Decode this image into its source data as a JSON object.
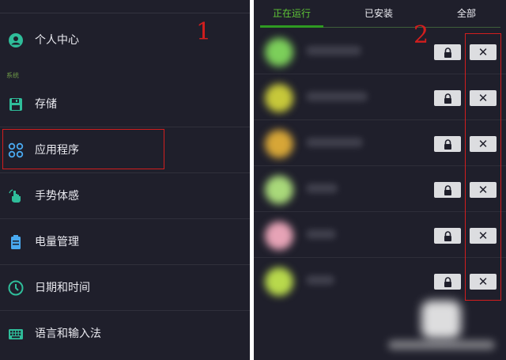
{
  "settings": {
    "section_label": "系统",
    "items": [
      {
        "label": "个人中心",
        "icon": "person-circle-icon"
      },
      {
        "label": "存储",
        "icon": "floppy-disk-icon"
      },
      {
        "label": "应用程序",
        "icon": "apps-grid-icon"
      },
      {
        "label": "手势体感",
        "icon": "gesture-hand-icon"
      },
      {
        "label": "电量管理",
        "icon": "battery-icon"
      },
      {
        "label": "日期和时间",
        "icon": "clock-icon"
      },
      {
        "label": "语言和输入法",
        "icon": "keyboard-icon"
      }
    ],
    "annotation_number": "1"
  },
  "apps": {
    "tabs": [
      {
        "label": "正在运行",
        "active": true
      },
      {
        "label": "已安装",
        "active": false
      },
      {
        "label": "全部",
        "active": false
      }
    ],
    "lock_icon": "lock-icon",
    "close_label": "✕",
    "annotation_number": "2",
    "rows": [
      {
        "icon_color": "#7ccf5a"
      },
      {
        "icon_color": "#c7c83a"
      },
      {
        "icon_color": "#d7a637"
      },
      {
        "icon_color": "#a9d97a"
      },
      {
        "icon_color": "#e6a3b6"
      },
      {
        "icon_color": "#b8d94c"
      }
    ]
  },
  "colors": {
    "background": "#1f1f2b",
    "accent_green": "#5fc637",
    "icon_teal": "#2fbd9a",
    "icon_blue": "#49a9f0",
    "annotation_red": "#d21e1e",
    "button_bg": "#dcdde0"
  }
}
